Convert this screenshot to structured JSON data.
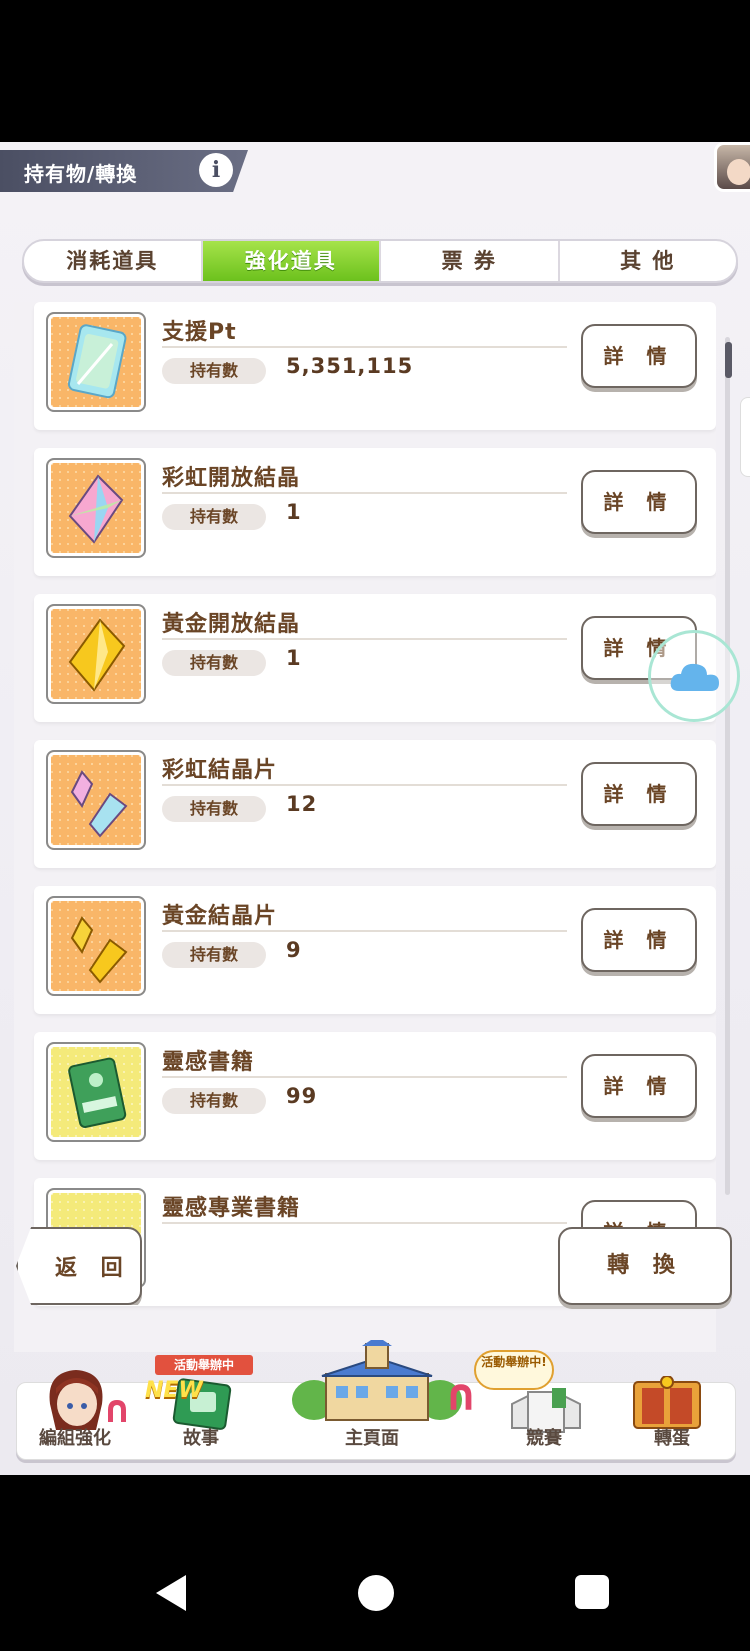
{
  "header": {
    "title": "持有物/轉換",
    "info_label": "i"
  },
  "tabs": [
    "消耗道具",
    "強化道具",
    "票 券",
    "其 他"
  ],
  "active_tab": "強化道具",
  "list": {
    "own_label": "持有數",
    "detail_label": "詳 情",
    "items": [
      {
        "name": "支援Pt",
        "count": "5,351,115",
        "icon": "support-pt-card-icon"
      },
      {
        "name": "彩虹開放結晶",
        "count": "1",
        "icon": "rainbow-crystal-icon"
      },
      {
        "name": "黃金開放結晶",
        "count": "1",
        "icon": "gold-crystal-icon"
      },
      {
        "name": "彩虹結晶片",
        "count": "12",
        "icon": "rainbow-shard-icon"
      },
      {
        "name": "黃金結晶片",
        "count": "9",
        "icon": "gold-shard-icon"
      },
      {
        "name": "靈感書籍",
        "count": "99",
        "icon": "book-icon"
      },
      {
        "name": "靈感專業書籍",
        "count": "",
        "icon": "pro-book-icon"
      }
    ]
  },
  "buttons": {
    "back": "返 回",
    "convert": "轉 換"
  },
  "menu": {
    "event_badge": "活動舉辦中",
    "new_badge": "NEW",
    "bubble": "活動舉辦中!",
    "items": [
      "編組強化",
      "故事",
      "主頁面",
      "競賽",
      "轉蛋"
    ]
  },
  "colors": {
    "accent_green": "#7ccc24",
    "text_brown": "#6a4526"
  }
}
